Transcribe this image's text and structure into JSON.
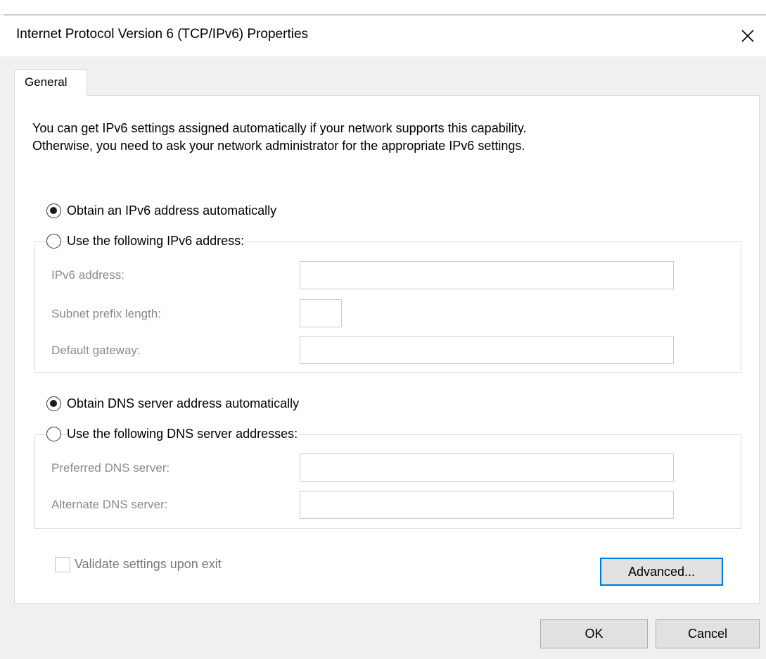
{
  "window": {
    "title": "Internet Protocol Version 6 (TCP/IPv6) Properties",
    "close_icon": "close-icon"
  },
  "tabs": [
    {
      "label": "General",
      "active": true
    }
  ],
  "intro": {
    "line1": "You can get IPv6 settings assigned automatically if your network supports this capability.",
    "line2": "Otherwise, you need to ask your network administrator for the appropriate IPv6 settings."
  },
  "address": {
    "auto_label": "Obtain an IPv6 address automatically",
    "auto_selected": true,
    "manual_label": "Use the following IPv6 address:",
    "manual_selected": false,
    "fields": [
      {
        "label": "IPv6 address:",
        "value": ""
      },
      {
        "label": "Subnet prefix length:",
        "value": ""
      },
      {
        "label": "Default gateway:",
        "value": ""
      }
    ]
  },
  "dns": {
    "auto_label": "Obtain DNS server address automatically",
    "auto_selected": true,
    "manual_label": "Use the following DNS server addresses:",
    "manual_selected": false,
    "fields": [
      {
        "label": "Preferred DNS server:",
        "value": ""
      },
      {
        "label": "Alternate DNS server:",
        "value": ""
      }
    ]
  },
  "validate": {
    "label": "Validate settings upon exit",
    "checked": false
  },
  "buttons": {
    "advanced": "Advanced...",
    "ok": "OK",
    "cancel": "Cancel"
  },
  "colors": {
    "accent": "#0078d7",
    "disabled_text": "#8a8a8a",
    "dialog_bg": "#f0f0f0"
  }
}
